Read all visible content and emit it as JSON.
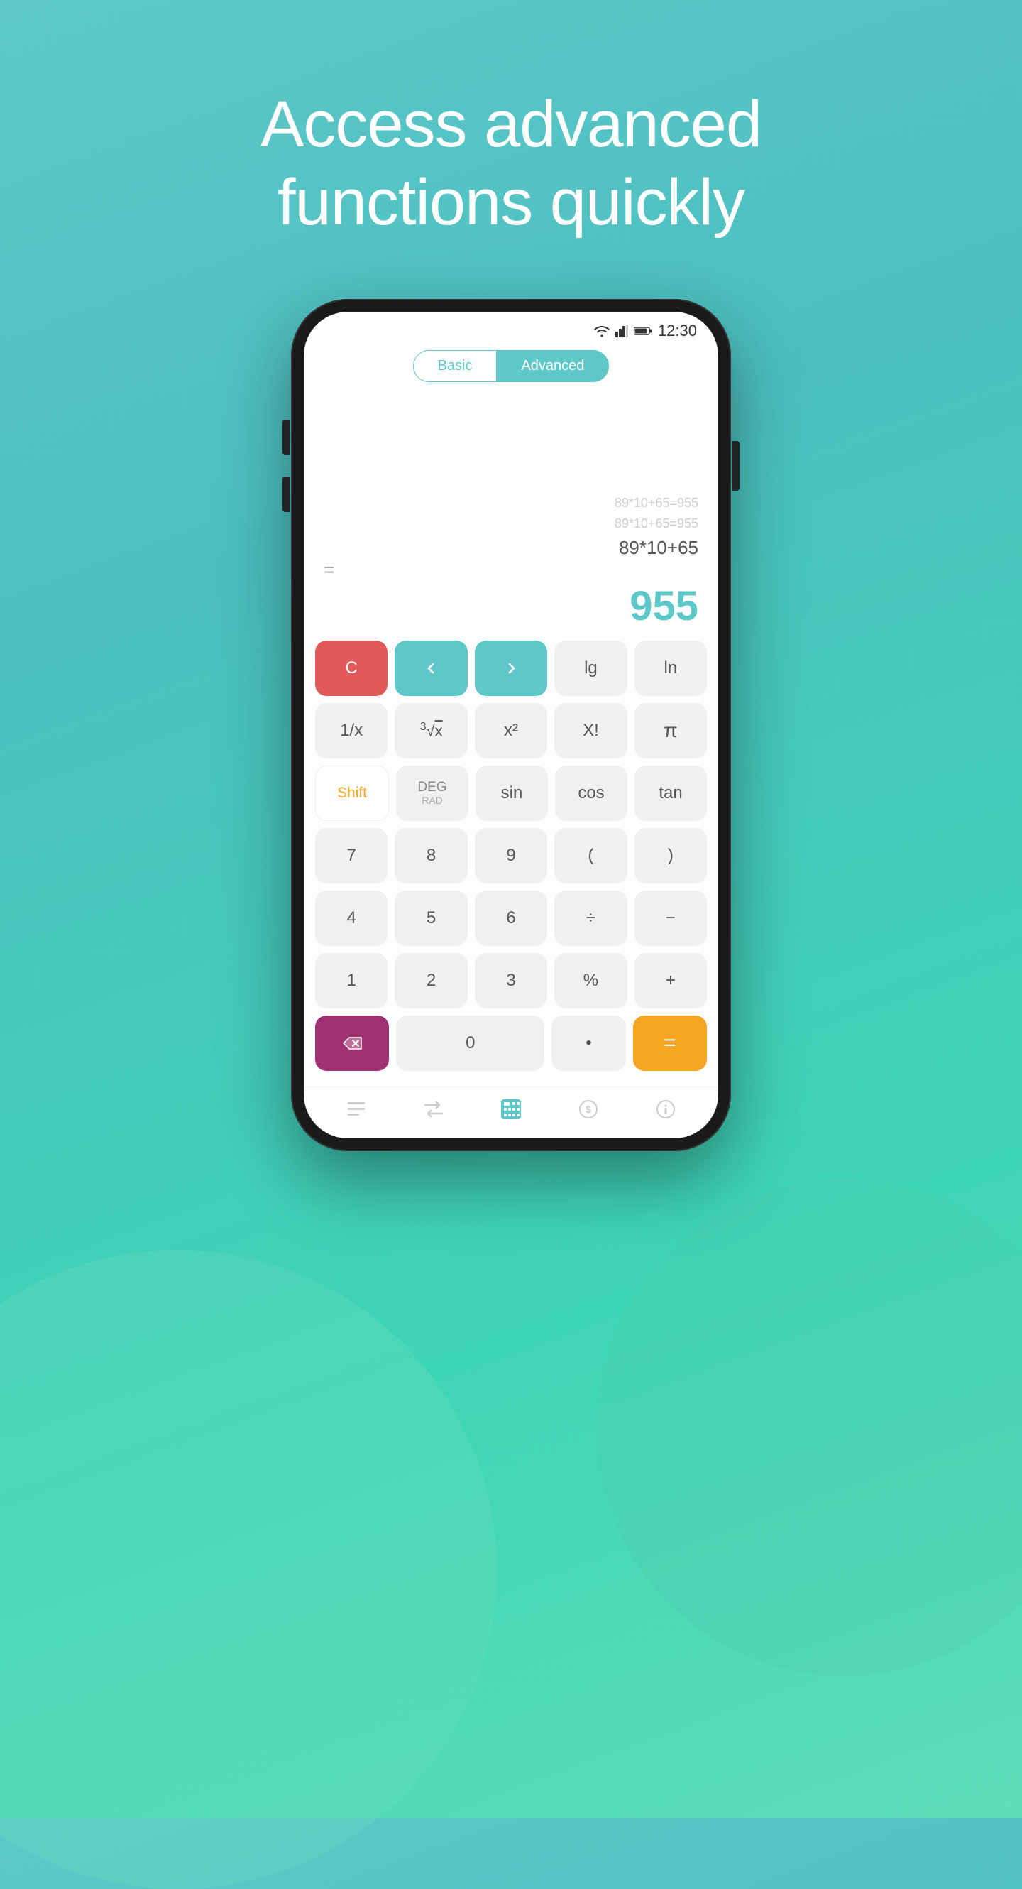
{
  "background": {
    "gradient_start": "#5ec8c8",
    "gradient_end": "#3dd6b5"
  },
  "headline": {
    "line1": "Access advanced",
    "line2": "functions quickly"
  },
  "status_bar": {
    "time": "12:30"
  },
  "tabs": {
    "basic_label": "Basic",
    "advanced_label": "Advanced"
  },
  "display": {
    "history_line1": "89*10+65=955",
    "history_line2": "89*10+65=955",
    "expression": "89*10+65",
    "equals": "=",
    "result": "955"
  },
  "keypad": {
    "row1": [
      {
        "label": "C",
        "type": "clear"
      },
      {
        "label": "‹",
        "type": "arrow"
      },
      {
        "label": "›",
        "type": "arrow"
      },
      {
        "label": "lg",
        "type": "func"
      },
      {
        "label": "ln",
        "type": "func"
      }
    ],
    "row2": [
      {
        "label": "1/x",
        "type": "func"
      },
      {
        "label": "∛",
        "type": "func"
      },
      {
        "label": "x²",
        "type": "func"
      },
      {
        "label": "X!",
        "type": "func"
      },
      {
        "label": "π",
        "type": "func"
      }
    ],
    "row3": [
      {
        "label": "Shift",
        "type": "shift"
      },
      {
        "label": "DEG",
        "sublabel": "RAD",
        "type": "deg"
      },
      {
        "label": "sin",
        "type": "func"
      },
      {
        "label": "cos",
        "type": "func"
      },
      {
        "label": "tan",
        "type": "func"
      }
    ],
    "row4": [
      {
        "label": "7",
        "type": "num"
      },
      {
        "label": "8",
        "type": "num"
      },
      {
        "label": "9",
        "type": "num"
      },
      {
        "label": "(",
        "type": "op"
      },
      {
        "label": ")",
        "type": "op"
      }
    ],
    "row5": [
      {
        "label": "4",
        "type": "num"
      },
      {
        "label": "5",
        "type": "num"
      },
      {
        "label": "6",
        "type": "num"
      },
      {
        "label": "÷",
        "type": "op"
      },
      {
        "label": "−",
        "type": "op"
      }
    ],
    "row6": [
      {
        "label": "1",
        "type": "num"
      },
      {
        "label": "2",
        "type": "num"
      },
      {
        "label": "3",
        "type": "num"
      },
      {
        "label": "%",
        "type": "op"
      },
      {
        "label": "+",
        "type": "op"
      }
    ],
    "row7": [
      {
        "label": "⌫",
        "type": "backspace"
      },
      {
        "label": "0",
        "type": "zero"
      },
      {
        "label": "•",
        "type": "dot"
      },
      {
        "label": "=",
        "type": "equals"
      }
    ]
  },
  "bottom_nav": {
    "icons": [
      "history",
      "convert",
      "calculator",
      "currency",
      "info"
    ]
  }
}
